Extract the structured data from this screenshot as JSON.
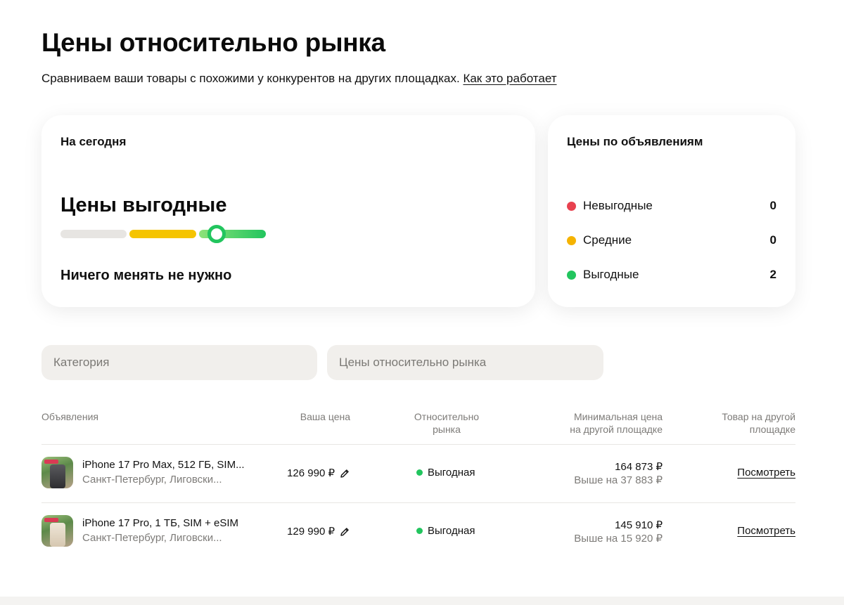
{
  "page": {
    "title": "Цены относительно рынка",
    "subtitle": "Сравниваем ваши товары с похожими у конкурентов на других площадках.",
    "help_link": "Как это работает"
  },
  "today_card": {
    "label": "На сегодня",
    "status": "Цены выгодные",
    "hint": "Ничего менять не нужно",
    "scale_level": "Выгодные",
    "scale_colors": [
      "#e7e5e2",
      "#f5c400",
      "#22c55e"
    ]
  },
  "ads_card": {
    "label": "Цены по объявлениям",
    "items": [
      {
        "label": "Невыгодные",
        "count": "0",
        "color": "#e8414f"
      },
      {
        "label": "Средние",
        "count": "0",
        "color": "#f5b300"
      },
      {
        "label": "Выгодные",
        "count": "2",
        "color": "#22c55e"
      }
    ]
  },
  "filters": {
    "category_placeholder": "Категория",
    "market_placeholder": "Цены относительно рынка"
  },
  "table": {
    "headers": {
      "ads": "Объявления",
      "price": "Ваша цена",
      "relative_line1": "Относительно",
      "relative_line2": "рынка",
      "min_line1": "Минимальная цена",
      "min_line2": "на другой площадке",
      "other_line1": "Товар на другой",
      "other_line2": "площадке"
    },
    "rows": [
      {
        "title": "iPhone 17 Pro Max, 512 ГБ, SIM...",
        "location": "Санкт-Петербург, Лиговски...",
        "price": "126 990 ₽",
        "relative": "Выгодная",
        "min_price": "164 873 ₽",
        "min_diff": "Выше на 37 883 ₽",
        "link": "Посмотреть"
      },
      {
        "title": "iPhone 17 Pro, 1 ТБ, SIM + eSIM",
        "location": "Санкт-Петербург, Лиговски...",
        "price": "129 990 ₽",
        "relative": "Выгодная",
        "min_price": "145 910 ₽",
        "min_diff": "Выше на 15 920 ₽",
        "link": "Посмотреть"
      }
    ]
  }
}
